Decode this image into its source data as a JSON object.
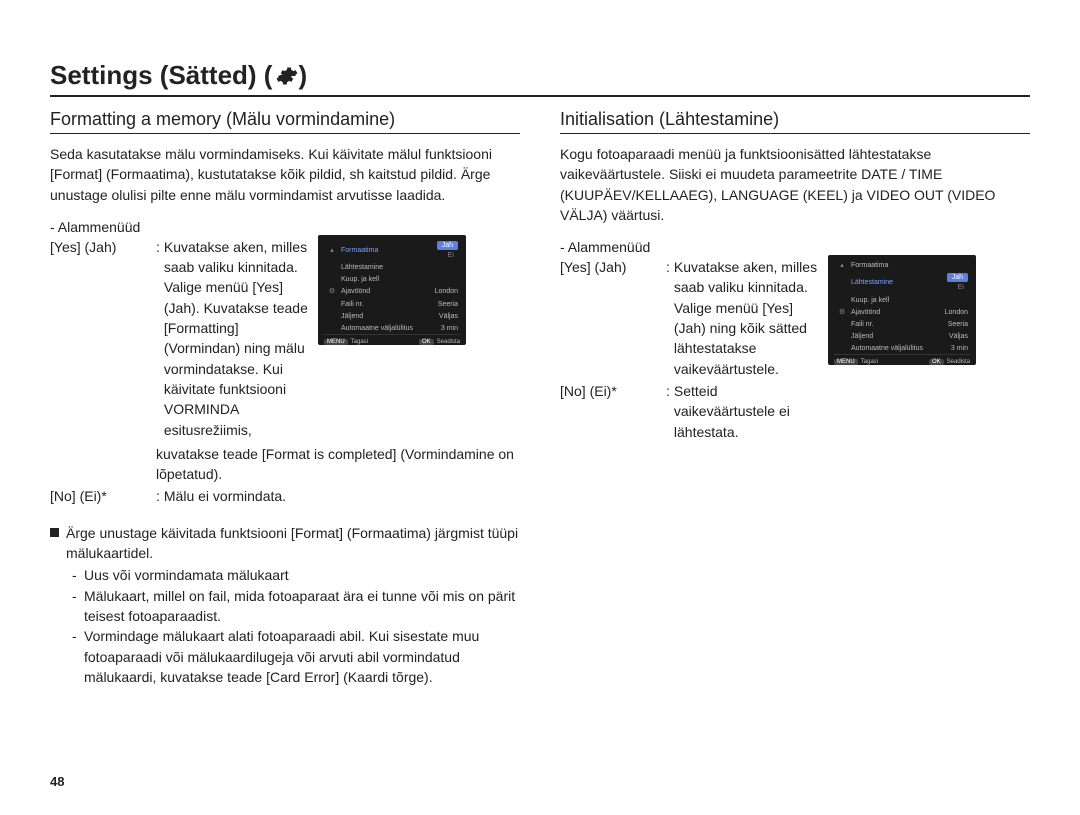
{
  "page_number": "48",
  "title_prefix": "Settings (Sätted) ( ",
  "title_suffix": " )",
  "left": {
    "heading": "Formatting a memory (Mälu vormindamine)",
    "intro": "Seda kasutatakse mälu vormindamiseks. Kui käivitate mälul funktsiooni [Format] (Formaatima), kustutatakse kõik pildid, sh kaitstud pildid. Ärge unustage olulisi pilte enne mälu vormindamist arvutisse laadida.",
    "submenus_label": "- Alammenüüd",
    "yes_label": "[Yes] (Jah)",
    "yes_colon": ":",
    "yes_text_side": "Kuvatakse aken, milles saab valiku kinnitada. Valige menüü [Yes] (Jah). Kuvatakse teade [Formatting] (Vormindan) ning mälu vormindatakse. Kui käivitate funktsiooni VORMINDA esitusrežiimis,",
    "yes_text_below": "kuvatakse teade [Format is completed] (Vormindamine on lõpetatud).",
    "no_label": "[No] (Ei)*",
    "no_colon": ":",
    "no_text": "Mälu ei vormindata.",
    "note_intro": "Ärge unustage käivitada funktsiooni [Format] (Formaatima) järgmist tüüpi mälukaartidel.",
    "note_items": [
      "Uus või vormindamata mälukaart",
      "Mälukaart, millel on fail, mida fotoaparaat ära ei tunne või mis on pärit teisest fotoaparaadist.",
      "Vormindage mälukaart alati fotoaparaadi abil. Kui sisestate muu fotoaparaadi või mälukaardilugeja või arvuti abil vormindatud mälukaardi, kuvatakse teade [Card Error] (Kaardi tõrge)."
    ]
  },
  "right": {
    "heading": "Initialisation (Lähtestamine)",
    "intro": "Kogu fotoaparaadi menüü ja funktsioonisätted lähtestatakse vaikeväärtustele. Siiski ei muudeta parameetrite DATE / TIME (KUUPÄEV/KELLAAEG), LANGUAGE (KEEL) ja VIDEO OUT (VIDEO VÄLJA) väärtusi.",
    "submenus_label": "- Alammenüüd",
    "yes_label": "[Yes] (Jah)",
    "yes_colon": ":",
    "yes_text_side": "Kuvatakse aken, milles saab valiku kinnitada. Valige menüü [Yes] (Jah) ning kõik sätted lähtestatakse vaikeväärtustele.",
    "no_label": "[No] (Ei)*",
    "no_colon": ":",
    "no_text": "Setteid vaikeväärtustele ei lähtestata."
  },
  "menu_left": {
    "highlight_index": 0,
    "highlight_value": "Jah",
    "items": [
      {
        "label": "Formaatima",
        "value": ""
      },
      {
        "label": "Lähtestamine",
        "value": ""
      },
      {
        "label": "Kuup. ja kell",
        "value": ""
      },
      {
        "label": "Ajavöönd",
        "value": "London"
      },
      {
        "label": "Faili nr.",
        "value": "Seeria"
      },
      {
        "label": "Jäljend",
        "value": "Väljas"
      },
      {
        "label": "Automaatne väljalülitus",
        "value": "3 min"
      }
    ],
    "footer_left_key": "MENU",
    "footer_left_label": "Tagasi",
    "footer_right_key": "OK",
    "footer_right_label": "Seadista"
  },
  "menu_right": {
    "highlight_index": 1,
    "highlight_value": "Jah",
    "items": [
      {
        "label": "Formaatima",
        "value": ""
      },
      {
        "label": "Lähtestamine",
        "value": ""
      },
      {
        "label": "Kuup. ja kell",
        "value": ""
      },
      {
        "label": "Ajavöönd",
        "value": "London"
      },
      {
        "label": "Faili nr.",
        "value": "Seeria"
      },
      {
        "label": "Jäljend",
        "value": "Väljas"
      },
      {
        "label": "Automaatne väljalülitus",
        "value": "3 min"
      }
    ],
    "footer_left_key": "MENU",
    "footer_left_label": "Tagasi",
    "footer_right_key": "OK",
    "footer_right_label": "Seadista"
  }
}
